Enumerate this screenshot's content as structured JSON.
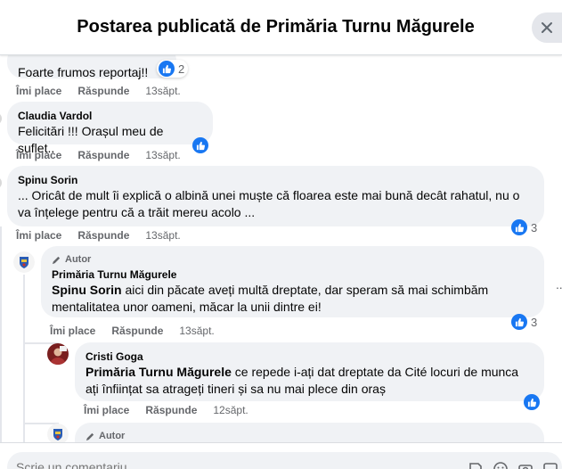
{
  "header": {
    "title": "Postarea publicată de Primăria Turnu Măgurele"
  },
  "comments": [
    {
      "text": "Foarte frumos reportaj!!",
      "reactions": "2",
      "like": "Îmi place",
      "reply": "Răspunde",
      "time": "13săpt."
    },
    {
      "author": "Claudia Vardol",
      "text": "Felicitări !!! Orașul meu de suflet..",
      "like": "Îmi place",
      "reply": "Răspunde",
      "time": "13săpt."
    },
    {
      "author": "Spinu Sorin",
      "text": "... Oricât de mult îi explică o albină unei muște că floarea este mai bună decât rahatul, nu o va înțelege pentru că a trăit mereu acolo ...",
      "reactions": "3",
      "like": "Îmi place",
      "reply": "Răspunde",
      "time": "13săpt."
    }
  ],
  "replies": [
    {
      "badge": "Autor",
      "author": "Primăria Turnu Măgurele",
      "mention": "Spinu Sorin",
      "text": " aici din păcate aveți multă dreptate, dar speram să mai schimbăm mentalitatea unor oameni, măcar la unii dintre ei!",
      "reactions": "3",
      "like": "Îmi place",
      "reply": "Răspunde",
      "time": "13săpt."
    },
    {
      "author": "Cristi Goga",
      "mention": "Primăria Turnu Măgurele",
      "text": " ce repede i-ați dat dreptate da Cité locuri de munca ați înființat sa atrageți tineri și sa nu mai plece din oraș",
      "like": "Îmi place",
      "reply": "Răspunde",
      "time": "12săpt."
    },
    {
      "badge": "Autor"
    }
  ],
  "composer": {
    "placeholder": "Scrie un comentariu..."
  },
  "more": "··",
  "colors": {
    "accent": "#1877f2",
    "bubble": "#f0f2f5",
    "muted": "#65676b"
  },
  "icons": [
    "close-icon",
    "like-icon",
    "pencil-icon",
    "emoji-icon",
    "camera-icon",
    "gif-icon",
    "sticker-icon"
  ]
}
